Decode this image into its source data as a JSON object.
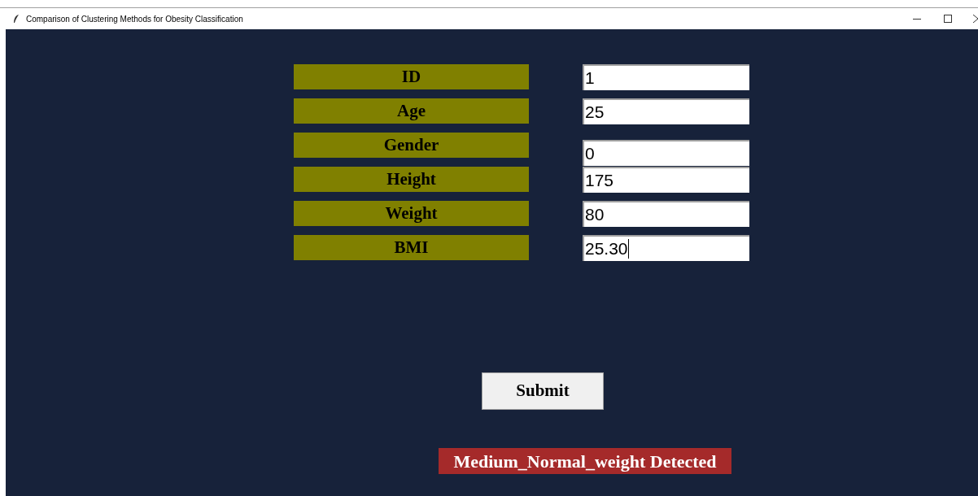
{
  "window": {
    "title": "Comparison of Clustering Methods for Obesity Classification"
  },
  "fields": [
    {
      "label": "ID",
      "value": "1",
      "focused": false
    },
    {
      "label": "Age",
      "value": "25",
      "focused": false
    },
    {
      "label": "Gender",
      "value": "0",
      "focused": false
    },
    {
      "label": "Height",
      "value": "175",
      "focused": false
    },
    {
      "label": "Weight",
      "value": "80",
      "focused": false
    },
    {
      "label": "BMI",
      "value": "25.30",
      "focused": true
    }
  ],
  "submit_button": "Submit",
  "result": "Medium_Normal_weight Detected"
}
